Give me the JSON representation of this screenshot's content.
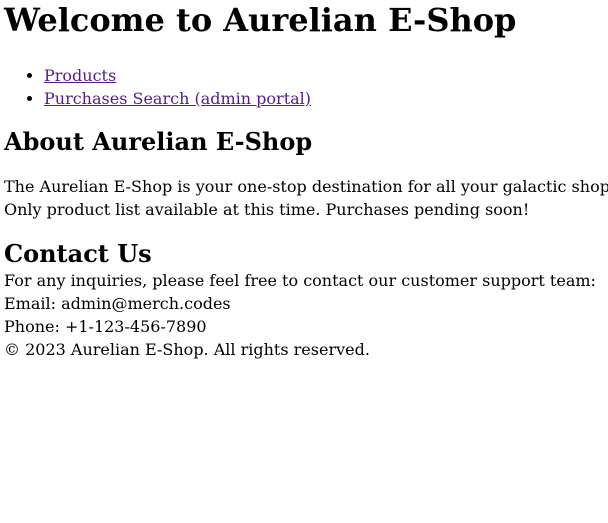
{
  "header": {
    "title": "Welcome to Aurelian E-Shop"
  },
  "nav": {
    "items": [
      {
        "label": "Products"
      },
      {
        "label": "Purchases Search (admin portal)"
      }
    ]
  },
  "about": {
    "heading": "About Aurelian E-Shop",
    "line1": "The Aurelian E-Shop is your one-stop destination for all your galactic shopping",
    "line2": "Only product list available at this time. Purchases pending soon!"
  },
  "contact": {
    "heading": "Contact Us",
    "intro": "For any inquiries, please feel free to contact our customer support team:",
    "email": "Email: admin@merch.codes",
    "phone": "Phone: +1-123-456-7890"
  },
  "footer": {
    "text": "© 2023 Aurelian E-Shop. All rights reserved."
  },
  "colors": {
    "link_visited": "#551a8b",
    "text": "#000000",
    "background": "#ffffff"
  }
}
